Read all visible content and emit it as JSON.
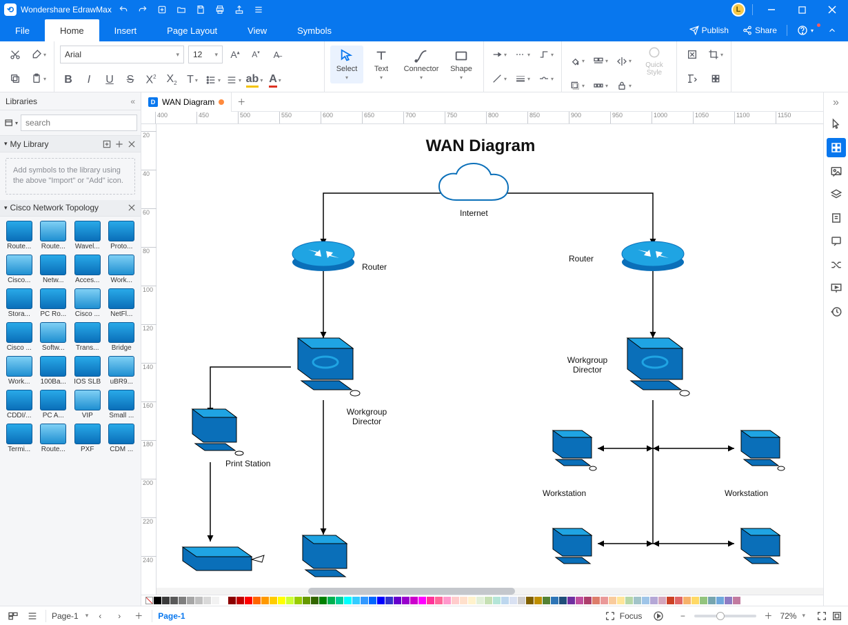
{
  "app": {
    "title": "Wondershare EdrawMax",
    "avatar_initial": "L"
  },
  "qat": [
    "undo",
    "redo",
    "new",
    "open",
    "save",
    "print",
    "export",
    "theme"
  ],
  "window_buttons": [
    "minimize",
    "maximize",
    "close"
  ],
  "menu": {
    "items": [
      "File",
      "Home",
      "Insert",
      "Page Layout",
      "View",
      "Symbols"
    ],
    "active": "Home",
    "right": {
      "publish": "Publish",
      "share": "Share"
    }
  },
  "ribbon": {
    "font_name": "Arial",
    "font_size": "12",
    "select_label": "Select",
    "text_label": "Text",
    "connector_label": "Connector",
    "shape_label": "Shape",
    "quick_style_label": "Quick Style"
  },
  "libraries": {
    "title": "Libraries",
    "search_placeholder": "search",
    "my_library": "My Library",
    "hint": "Add symbols to the library using the above \"Import\" or \"Add\" icon.",
    "topology_title": "Cisco Network Topology",
    "items": [
      "Route...",
      "Route...",
      "Wavel...",
      "Proto...",
      "Cisco...",
      "Netw...",
      "Acces...",
      "Work...",
      "Stora...",
      "PC Ro...",
      "Cisco ...",
      "NetFl...",
      "Cisco ...",
      "Softw...",
      "Trans...",
      "Bridge",
      "Work...",
      "100Ba...",
      "IOS SLB",
      "uBR9...",
      "CDDI/...",
      "PC A...",
      "VIP",
      "Small ...",
      "Termi...",
      "Route...",
      "PXF",
      "CDM ..."
    ]
  },
  "doc_tab": {
    "name": "WAN Diagram",
    "dirty": true
  },
  "ruler_h": [
    400,
    450,
    500,
    550,
    600,
    650,
    700,
    750,
    800,
    850,
    900,
    950,
    1000,
    1050,
    1100,
    1150
  ],
  "ruler_v": [
    20,
    40,
    60,
    80,
    100,
    120,
    140,
    160,
    180,
    200,
    220,
    240
  ],
  "diagram": {
    "title": "WAN Diagram",
    "labels": {
      "internet": "Internet",
      "router_l": "Router",
      "router_r": "Router",
      "wg_l": "Workgroup Director",
      "wg_r": "Workgroup Director",
      "print": "Print Station",
      "ws1": "Workstation",
      "ws2": "Workstation"
    }
  },
  "pages": {
    "selector": "Page-1",
    "current": "Page-1"
  },
  "status": {
    "focus": "Focus",
    "zoom": "72%"
  },
  "colors": [
    "#000000",
    "#3b3b3b",
    "#595959",
    "#7f7f7f",
    "#a6a6a6",
    "#bfbfbf",
    "#d9d9d9",
    "#f2f2f2",
    "#ffffff",
    "#8b0000",
    "#c00000",
    "#ff0000",
    "#ff6600",
    "#ff9900",
    "#ffcc00",
    "#ffff00",
    "#ccff33",
    "#99cc00",
    "#669900",
    "#336600",
    "#008000",
    "#00b050",
    "#00cc99",
    "#00ffff",
    "#33ccff",
    "#3399ff",
    "#0066ff",
    "#0000ff",
    "#3333cc",
    "#6600cc",
    "#9900cc",
    "#cc00cc",
    "#ff00ff",
    "#ff3399",
    "#ff6699",
    "#ff99cc",
    "#ffcccc",
    "#ffe0cc",
    "#fff2cc",
    "#e2f0d9",
    "#c6e0b4",
    "#b4e5d8",
    "#bdd7ee",
    "#d9e1f2",
    "#d0cece",
    "#806000",
    "#bf8f00",
    "#548235",
    "#2e75b6",
    "#1f4e79",
    "#7030a0",
    "#c04f9e",
    "#ad3f6c",
    "#dd7e6b",
    "#ea9999",
    "#f9cb9c",
    "#ffe599",
    "#b6d7a8",
    "#a2c4c9",
    "#9fc5e8",
    "#b4a7d6",
    "#d5a6bd",
    "#cc4125",
    "#e06666",
    "#f6b26b",
    "#ffd966",
    "#93c47d",
    "#76a5af",
    "#6fa8dc",
    "#8e7cc3",
    "#c27ba0"
  ]
}
